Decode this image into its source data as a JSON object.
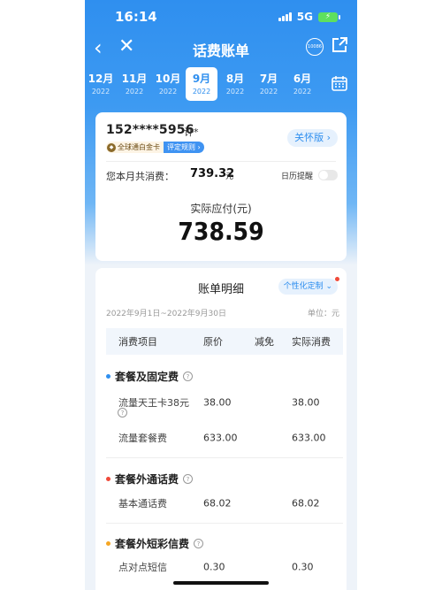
{
  "status": {
    "time": "16:14",
    "network": "5G"
  },
  "nav": {
    "title": "话费账单",
    "service_label": "10086"
  },
  "months": [
    {
      "m": "12月",
      "y": "2022"
    },
    {
      "m": "11月",
      "y": "2022"
    },
    {
      "m": "10月",
      "y": "2022"
    },
    {
      "m": "9月",
      "y": "2022"
    },
    {
      "m": "8月",
      "y": "2022"
    },
    {
      "m": "7月",
      "y": "2022"
    },
    {
      "m": "6月",
      "y": "2022"
    }
  ],
  "account": {
    "phone": "152****5956",
    "owner": "许*",
    "card_tag": "全球通白金卡",
    "rating_rule": "评定规则 ›",
    "care_label": "关怀版 ›",
    "consumption_label": "您本月共消费：",
    "consumption_value": "739.32",
    "consumption_unit": "元",
    "reminder_label": "日历提醒",
    "due_label": "实际应付(元)",
    "due_value": "738.59"
  },
  "bill": {
    "title": "账单明细",
    "custom_label": "个性化定制 ⌄",
    "period": "2022年9月1日~2022年9月30日",
    "unit": "单位：元",
    "headers": [
      "消费项目",
      "原价",
      "减免",
      "实际消费"
    ],
    "sections": [
      {
        "name": "套餐及固定费",
        "color": "#2f8fef",
        "rows": [
          {
            "item": "流量天王卡38元",
            "orig": "38.00",
            "disc": "",
            "actual": "38.00"
          },
          {
            "item": "流量套餐费",
            "orig": "633.00",
            "disc": "",
            "actual": "633.00"
          }
        ]
      },
      {
        "name": "套餐外通话费",
        "color": "#f04a3a",
        "rows": [
          {
            "item": "基本通话费",
            "orig": "68.02",
            "disc": "",
            "actual": "68.02"
          }
        ]
      },
      {
        "name": "套餐外短彩信费",
        "color": "#f5a623",
        "rows": [
          {
            "item": "点对点短信",
            "orig": "0.30",
            "disc": "",
            "actual": "0.30"
          }
        ]
      }
    ]
  }
}
